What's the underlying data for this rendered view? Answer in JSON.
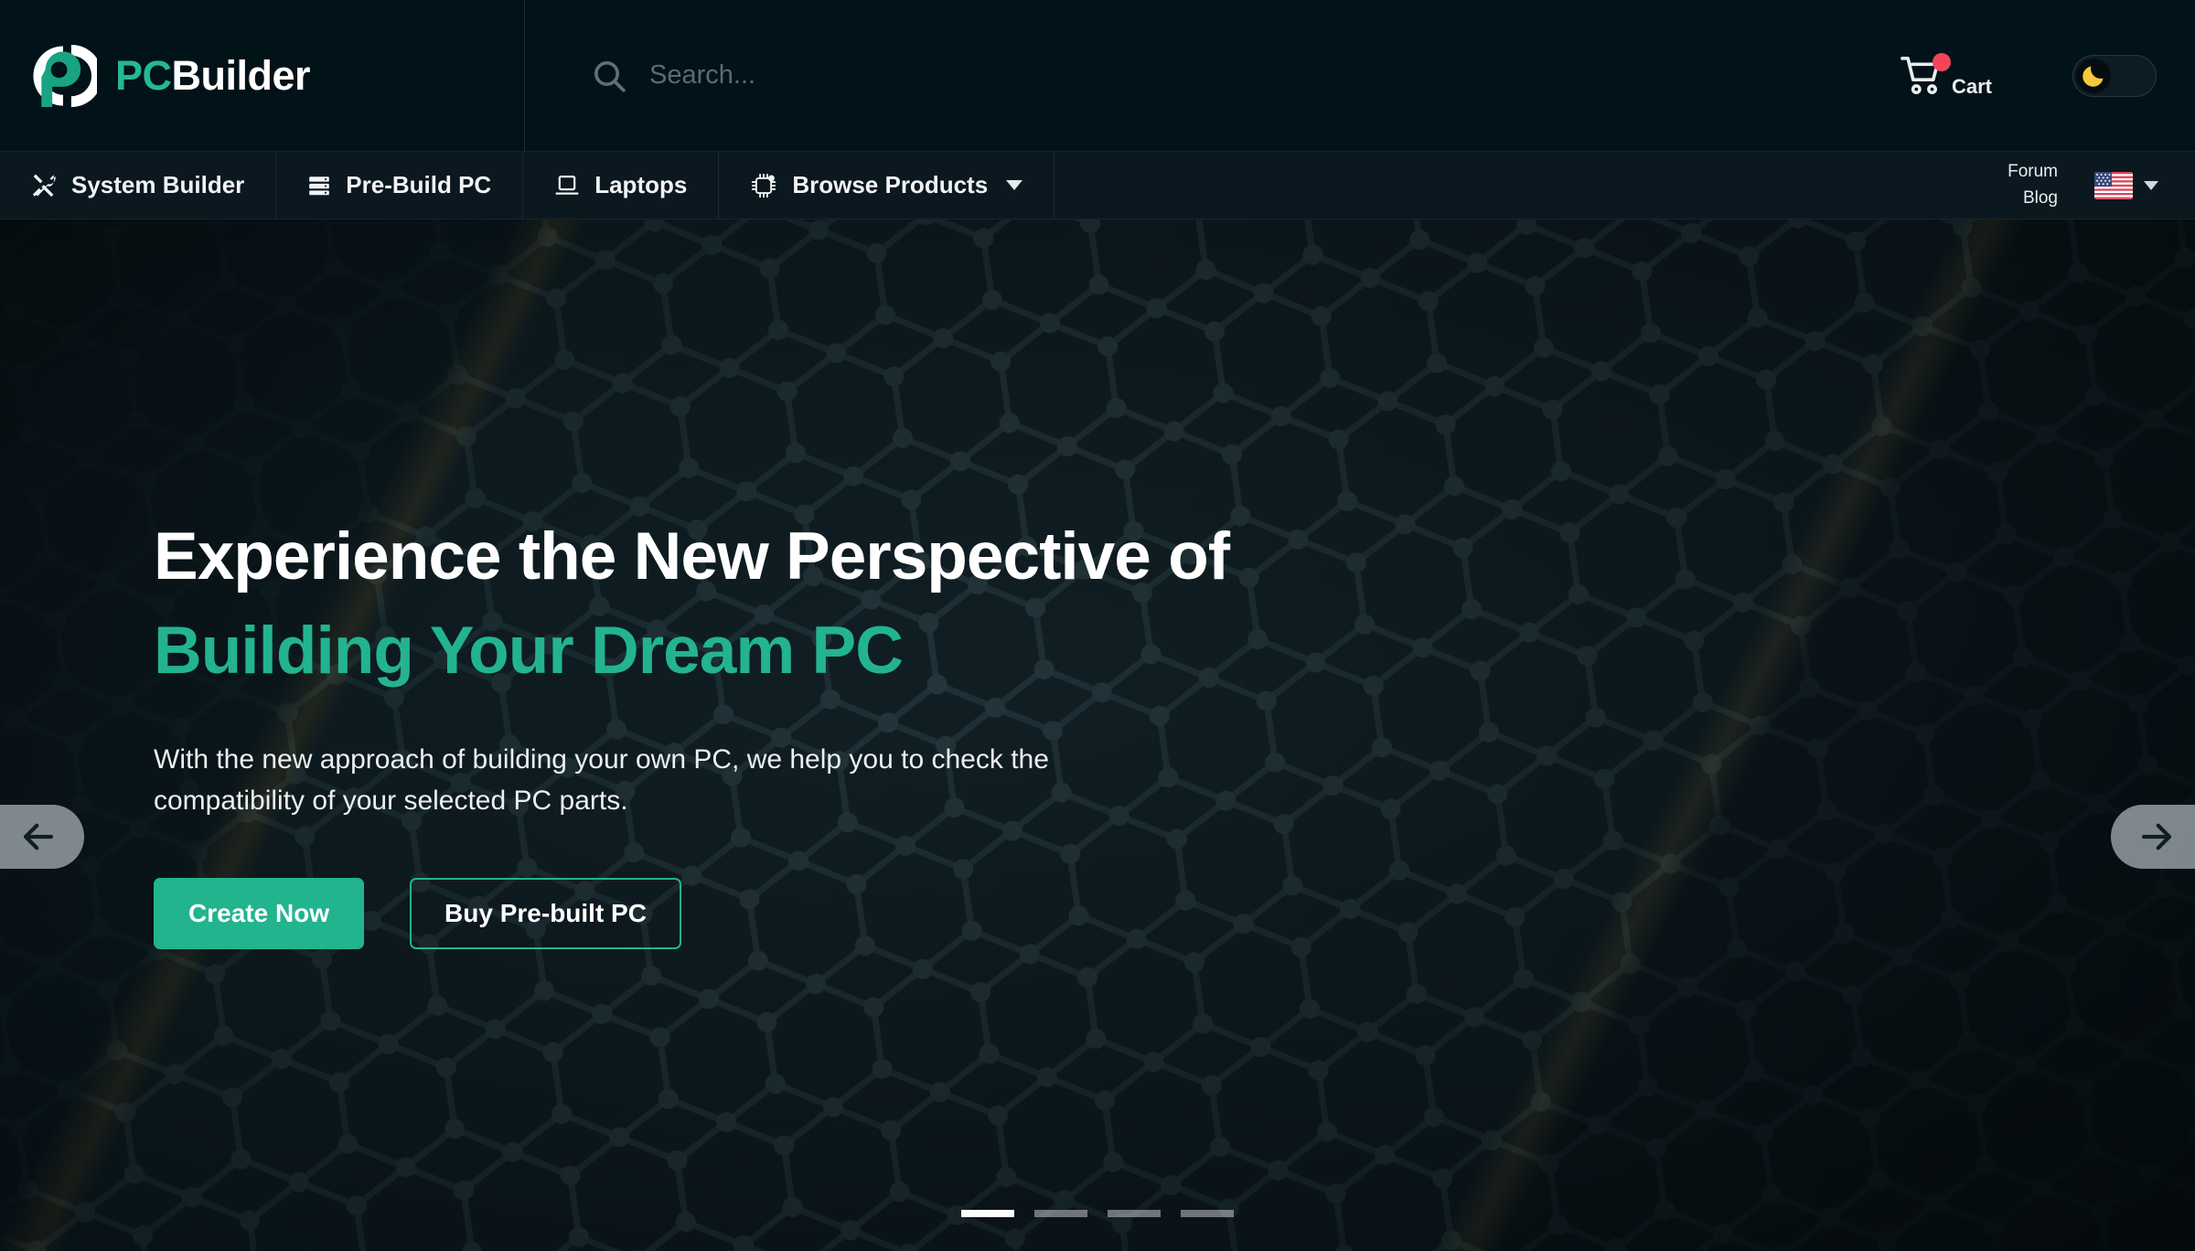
{
  "header": {
    "brand": {
      "part1": "PC",
      "part2": "Builder"
    },
    "search": {
      "value": "",
      "placeholder": "Search..."
    },
    "cart": {
      "label": "Cart",
      "badge_color": "#f2455a"
    },
    "theme_toggle": {
      "state": "dark",
      "icon": "moon-icon"
    }
  },
  "nav": {
    "items": [
      {
        "label": "System Builder",
        "icon": "tools-icon",
        "has_dropdown": false
      },
      {
        "label": "Pre-Build PC",
        "icon": "server-icon",
        "has_dropdown": false
      },
      {
        "label": "Laptops",
        "icon": "laptop-icon",
        "has_dropdown": false
      },
      {
        "label": "Browse Products",
        "icon": "cpu-chip-icon",
        "has_dropdown": true
      }
    ],
    "links": [
      {
        "label": "Forum"
      },
      {
        "label": "Blog"
      }
    ],
    "language": {
      "flag": "us-flag-icon",
      "has_dropdown": true
    }
  },
  "hero": {
    "heading_line1": "Experience the New Perspective of",
    "heading_line2": "Building Your Dream PC",
    "subtext": "With the new approach of building your own PC, we help you to check the compatibility of your selected PC parts.",
    "primary_button": "Create Now",
    "secondary_button": "Buy Pre-built PC",
    "prev_arrow": "←",
    "next_arrow": "→",
    "slides": 4,
    "active_slide": 1
  },
  "colors": {
    "accent": "#22b48f",
    "brand_teal": "#23b896",
    "heading_teal": "#23b391",
    "topbar_bg": "#011218",
    "nav_bg": "#0b181f",
    "hero_bg": "#0b191f",
    "badge_red": "#f2455a",
    "moon_yellow": "#f5c93b"
  }
}
